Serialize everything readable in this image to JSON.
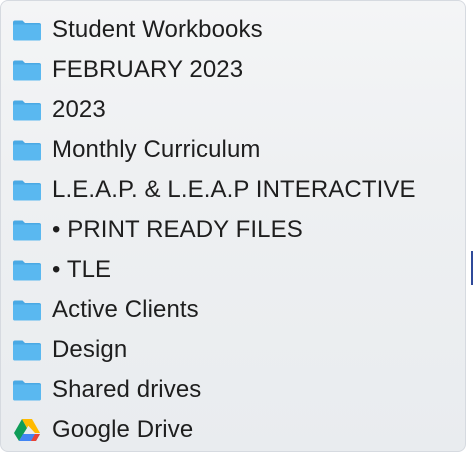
{
  "menu": {
    "items": [
      {
        "label": "Student Workbooks",
        "icon": "folder-icon"
      },
      {
        "label": "FEBRUARY 2023",
        "icon": "folder-icon"
      },
      {
        "label": "2023",
        "icon": "folder-icon"
      },
      {
        "label": "Monthly Curriculum",
        "icon": "folder-icon"
      },
      {
        "label": "L.E.A.P. & L.E.A.P INTERACTIVE",
        "icon": "folder-icon"
      },
      {
        "label": "• PRINT READY FILES",
        "icon": "folder-icon"
      },
      {
        "label": "• TLE",
        "icon": "folder-icon"
      },
      {
        "label": "Active Clients",
        "icon": "folder-icon"
      },
      {
        "label": "Design",
        "icon": "folder-icon"
      },
      {
        "label": "Shared drives",
        "icon": "folder-icon"
      },
      {
        "label": "Google Drive",
        "icon": "google-drive-icon"
      }
    ]
  },
  "colors": {
    "folder_fill": "#5ab8f0",
    "folder_tab": "#4aa9e4",
    "text": "#1e1e1e"
  }
}
